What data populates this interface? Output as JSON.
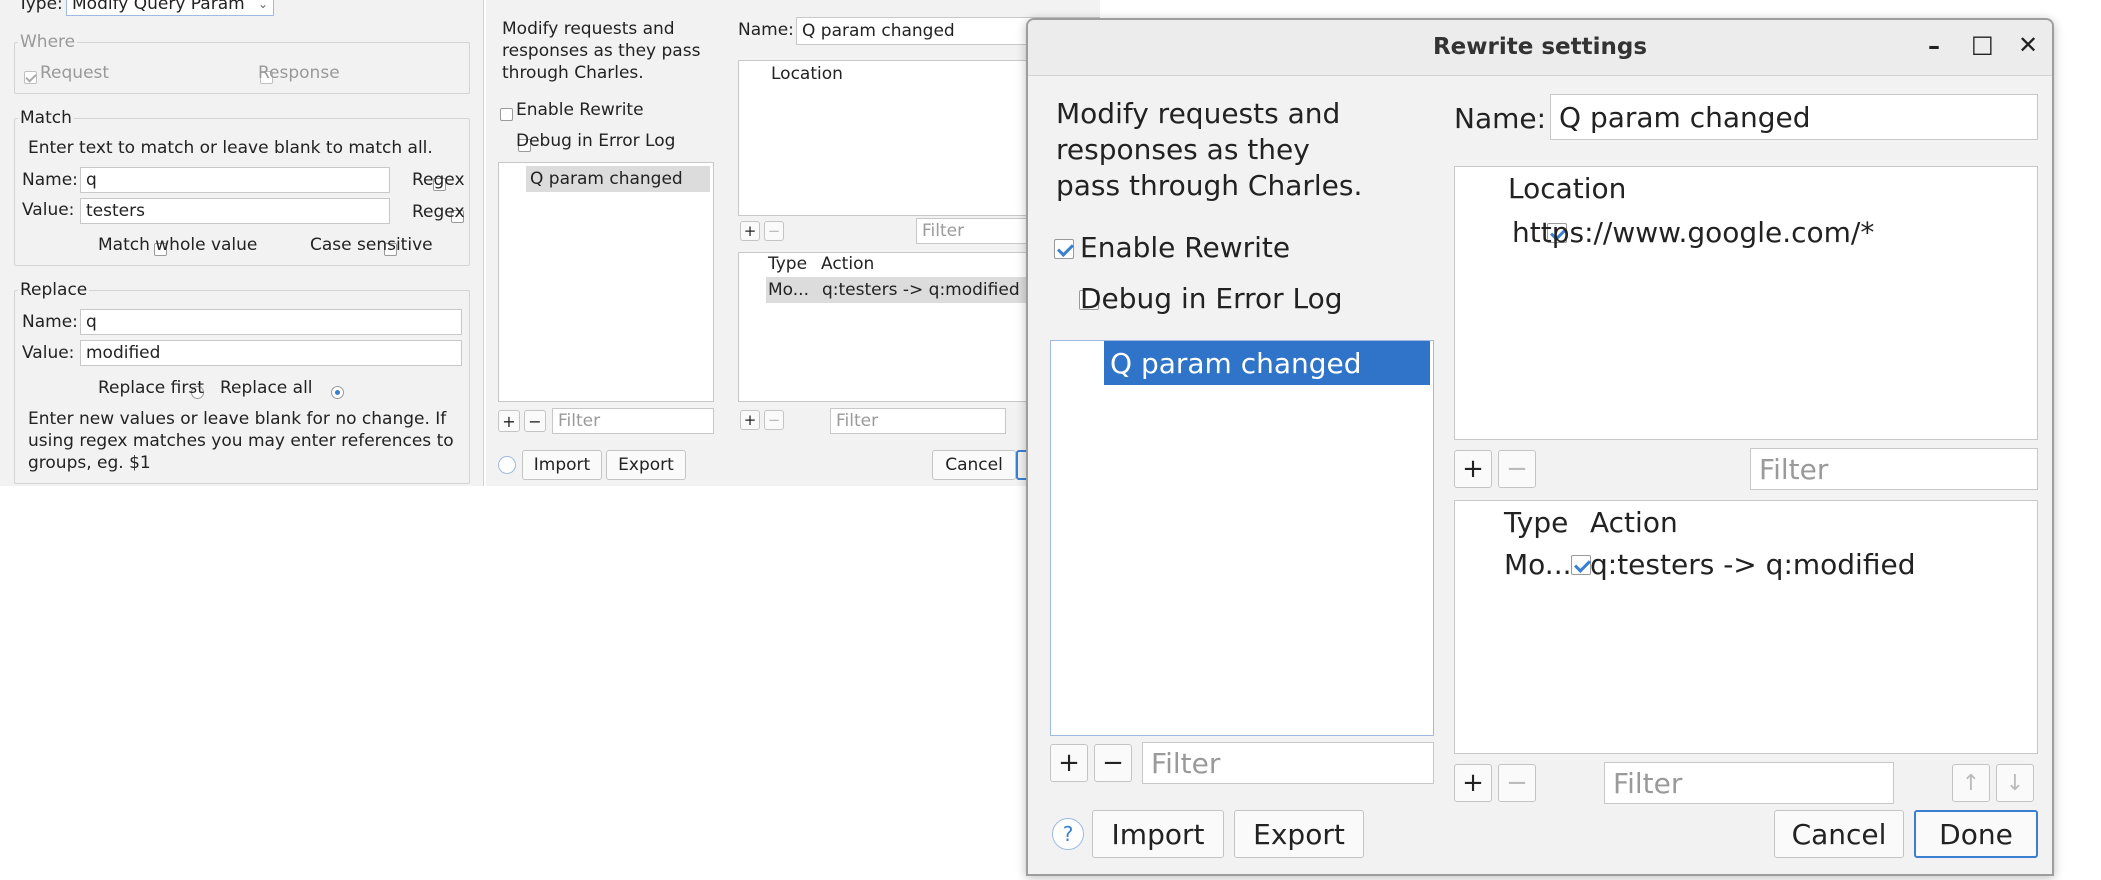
{
  "bg_match": {
    "type_label": "Type:",
    "type_value": "Modify Query Param",
    "where": {
      "title": "Where",
      "request": "Request",
      "response": "Response"
    },
    "match": {
      "title": "Match",
      "hint": "Enter text to match or leave blank to match all.",
      "name_label": "Name:",
      "name_value": "q",
      "value_label": "Value:",
      "value_value": "testers",
      "regex": "Regex",
      "regex2": "Regex",
      "match_whole": "Match whole value",
      "case_sensitive": "Case sensitive"
    },
    "replace": {
      "title": "Replace",
      "name_label": "Name:",
      "name_value": "q",
      "value_label": "Value:",
      "value_value": "modified",
      "replace_first": "Replace first",
      "replace_all": "Replace all",
      "note": "Enter new values or leave blank for no change. If using regex matches you may enter references to groups, eg. $1"
    }
  },
  "bg_rewrite": {
    "description": "Modify requests and responses as they pass through Charles.",
    "enable_rewrite": "Enable Rewrite",
    "debug": "Debug in Error Log",
    "set_item": "Q param changed",
    "name_label": "Name:",
    "name_value": "Q param changed",
    "location_header": "Location",
    "filter": "Filter",
    "type_header": "Type",
    "action_header": "Action",
    "rule_type": "Mo...",
    "rule_action": "q:testers -> q:modified",
    "import": "Import",
    "export": "Export",
    "cancel": "Cancel",
    "plus": "+",
    "minus": "−"
  },
  "dialog": {
    "title": "Rewrite settings",
    "description": "Modify requests and responses as they pass through Charles.",
    "enable_rewrite": "Enable Rewrite",
    "debug": "Debug in Error Log",
    "set_item": "Q param changed",
    "name_label": "Name:",
    "name_value": "Q param changed",
    "location_header": "Location",
    "location_value": "https://www.google.com/*",
    "filter": "Filter",
    "type_header": "Type",
    "action_header": "Action",
    "rule_type": "Mo...",
    "rule_action": "q:testers -> q:modified",
    "import": "Import",
    "export": "Export",
    "cancel": "Cancel",
    "done": "Done",
    "plus": "+",
    "minus": "−",
    "up": "↑",
    "down": "↓",
    "help": "?",
    "minimize": "–",
    "maximize": "□",
    "close": "✕"
  },
  "colors": {
    "accent": "#2f74c8",
    "panel": "#f2f2f2",
    "border": "#c8c8c8"
  }
}
